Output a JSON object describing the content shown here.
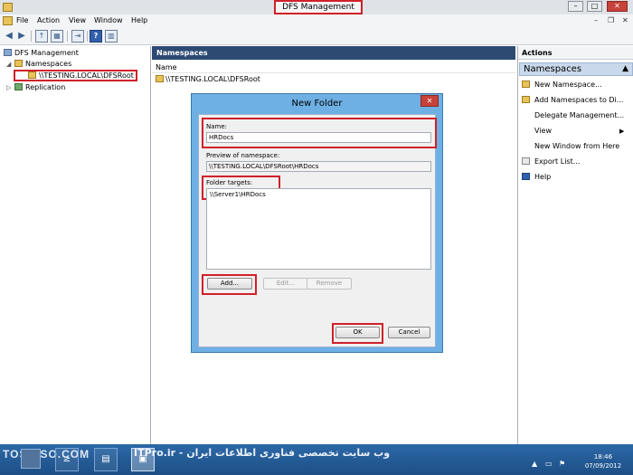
{
  "window": {
    "title": "DFS Management",
    "controls": {
      "minimize": "–",
      "maximize": "□",
      "close": "✕"
    }
  },
  "menu": {
    "items": [
      "File",
      "Action",
      "View",
      "Window",
      "Help"
    ],
    "right_controls": {
      "minimize": "–",
      "restore": "❐",
      "close": "✕"
    }
  },
  "tree": {
    "root": "DFS Management",
    "namespaces": "Namespaces",
    "namespace_root": "\\\\TESTING.LOCAL\\DFSRoot",
    "replication": "Replication"
  },
  "middle": {
    "header": "Namespaces",
    "column": "Name",
    "rows": [
      "\\\\TESTING.LOCAL\\DFSRoot"
    ]
  },
  "actions": {
    "title": "Actions",
    "section": "Namespaces",
    "items": [
      {
        "label": "New Namespace...",
        "icon": "namespace-icon"
      },
      {
        "label": "Add Namespaces to Di...",
        "icon": "namespace-icon"
      },
      {
        "label": "Delegate Management...",
        "icon": "none"
      },
      {
        "label": "View",
        "icon": "none",
        "submenu": true
      },
      {
        "label": "New Window from Here",
        "icon": "none"
      },
      {
        "label": "Export List...",
        "icon": "export-icon"
      },
      {
        "label": "Help",
        "icon": "help-icon"
      }
    ]
  },
  "dialog": {
    "title": "New Folder",
    "close": "✕",
    "name_label": "Name:",
    "name_value": "HRDocs",
    "preview_label": "Preview of namespace:",
    "preview_value": "\\\\TESTING.LOCAL\\DFSRoot\\HRDocs",
    "targets_label": "Folder targets:",
    "targets": [
      "\\\\Server1\\HRDocs"
    ],
    "buttons": {
      "add": "Add...",
      "edit": "Edit...",
      "remove": "Remove",
      "ok": "OK",
      "cancel": "Cancel"
    }
  },
  "taskbar": {
    "watermark_left": "TOSINSO.COM",
    "watermark_mid": "وب سایت تخصصی فناوری اطلاعات ایران - ITPro.ir",
    "clock_time": "18:46",
    "clock_date": "07/09/2012"
  },
  "colors": {
    "highlight": "#d0202a",
    "pane_header": "#2d4a73",
    "dialog_frame": "#6eb0e3",
    "taskbar": "#2c68a7"
  }
}
